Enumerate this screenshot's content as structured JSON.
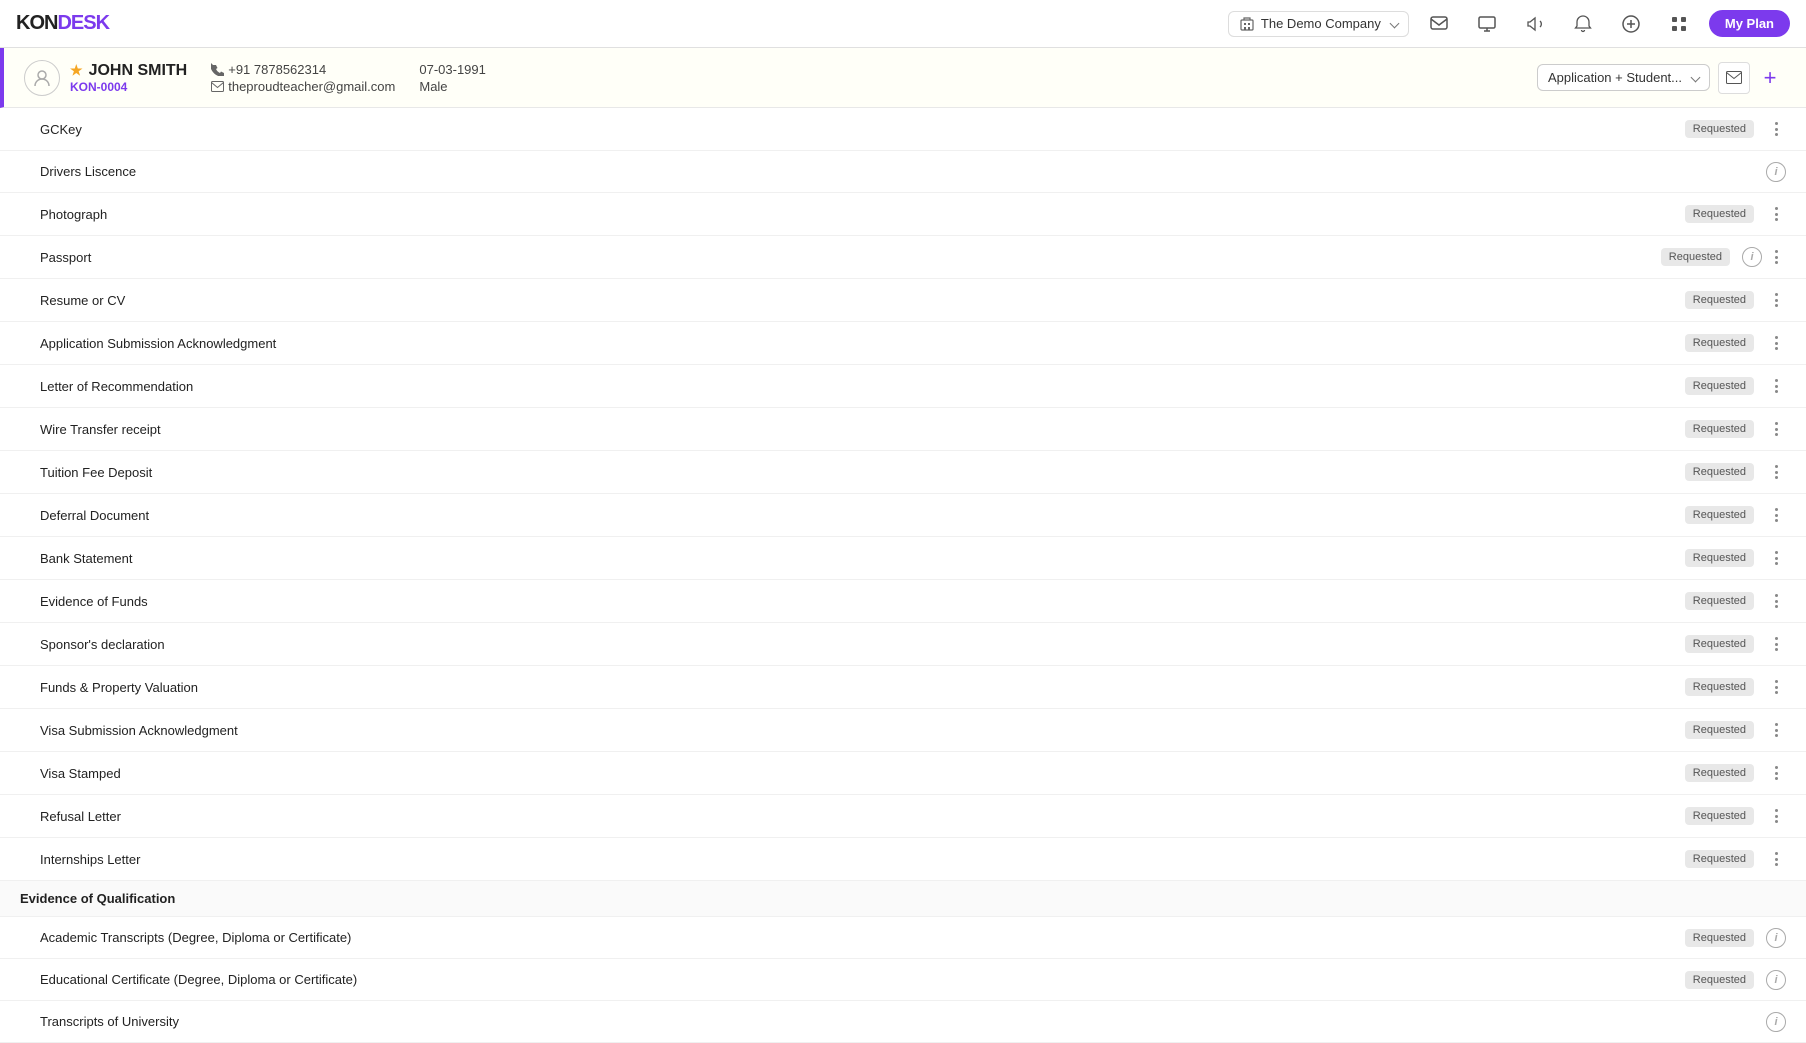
{
  "logo": {
    "part1": "KON",
    "part2": "DESK"
  },
  "topnav": {
    "company": "The Demo Company",
    "my_plan_label": "My Plan"
  },
  "contact": {
    "name": "JOHN SMITH",
    "id": "KON-0004",
    "phone": "+91 7878562314",
    "email": "theproudteacher@gmail.com",
    "dob": "07-03-1991",
    "gender": "Male",
    "app_selector_label": "Application + Student..."
  },
  "documents": [
    {
      "id": "gckey",
      "name": "GCKey",
      "status": "Requested",
      "has_info": false,
      "has_more": true,
      "is_section": false
    },
    {
      "id": "drivers-licence",
      "name": "Drivers Liscence",
      "status": null,
      "has_info": true,
      "has_more": false,
      "is_section": false
    },
    {
      "id": "photograph",
      "name": "Photograph",
      "status": "Requested",
      "has_info": false,
      "has_more": true,
      "is_section": false
    },
    {
      "id": "passport",
      "name": "Passport",
      "status": "Requested",
      "has_info": true,
      "has_more": true,
      "is_section": false
    },
    {
      "id": "resume-cv",
      "name": "Resume or CV",
      "status": "Requested",
      "has_info": false,
      "has_more": true,
      "is_section": false
    },
    {
      "id": "app-submission-ack",
      "name": "Application Submission Acknowledgment",
      "status": "Requested",
      "has_info": false,
      "has_more": true,
      "is_section": false
    },
    {
      "id": "letter-recommendation",
      "name": "Letter of Recommendation",
      "status": "Requested",
      "has_info": false,
      "has_more": true,
      "is_section": false
    },
    {
      "id": "wire-transfer",
      "name": "Wire Transfer receipt",
      "status": "Requested",
      "has_info": false,
      "has_more": true,
      "is_section": false
    },
    {
      "id": "tuition-fee",
      "name": "Tuition Fee Deposit",
      "status": "Requested",
      "has_info": false,
      "has_more": true,
      "is_section": false
    },
    {
      "id": "deferral-doc",
      "name": "Deferral Document",
      "status": "Requested",
      "has_info": false,
      "has_more": true,
      "is_section": false
    },
    {
      "id": "bank-statement",
      "name": "Bank Statement",
      "status": "Requested",
      "has_info": false,
      "has_more": true,
      "is_section": false
    },
    {
      "id": "evidence-funds",
      "name": "Evidence of Funds",
      "status": "Requested",
      "has_info": false,
      "has_more": true,
      "is_section": false
    },
    {
      "id": "sponsors-declaration",
      "name": "Sponsor's declaration",
      "status": "Requested",
      "has_info": false,
      "has_more": true,
      "is_section": false
    },
    {
      "id": "funds-property",
      "name": "Funds & Property Valuation",
      "status": "Requested",
      "has_info": false,
      "has_more": true,
      "is_section": false
    },
    {
      "id": "visa-submission-ack",
      "name": "Visa Submission Acknowledgment",
      "status": "Requested",
      "has_info": false,
      "has_more": true,
      "is_section": false
    },
    {
      "id": "visa-stamped",
      "name": "Visa Stamped",
      "status": "Requested",
      "has_info": false,
      "has_more": true,
      "is_section": false
    },
    {
      "id": "refusal-letter",
      "name": "Refusal Letter",
      "status": "Requested",
      "has_info": false,
      "has_more": true,
      "is_section": false
    },
    {
      "id": "internships-letter",
      "name": "Internships Letter",
      "status": "Requested",
      "has_info": false,
      "has_more": true,
      "is_section": false
    },
    {
      "id": "section-evidence",
      "name": "Evidence of Qualification",
      "status": null,
      "has_info": false,
      "has_more": false,
      "is_section": true
    },
    {
      "id": "academic-transcripts",
      "name": "Academic Transcripts (Degree, Diploma or Certificate)",
      "status": "Requested",
      "has_info": true,
      "has_more": false,
      "is_section": false
    },
    {
      "id": "educational-certificate",
      "name": "Educational Certificate (Degree, Diploma or Certificate)",
      "status": "Requested",
      "has_info": true,
      "has_more": false,
      "is_section": false
    },
    {
      "id": "transcripts-university",
      "name": "Transcripts of University",
      "status": null,
      "has_info": true,
      "has_more": false,
      "is_section": false
    }
  ]
}
